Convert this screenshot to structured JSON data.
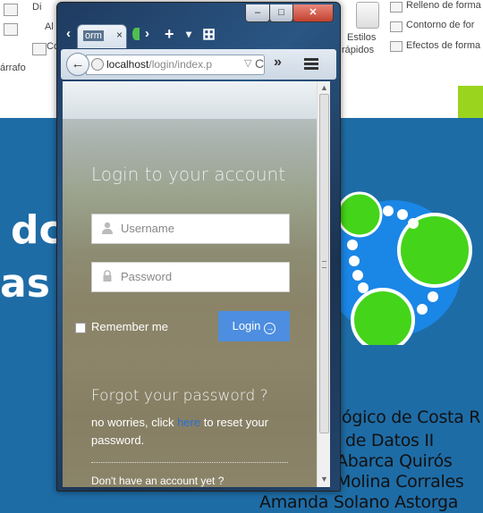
{
  "ribbon": {
    "paragraph_label": "árrafo",
    "di_label": "Di",
    "al_label": "Al",
    "co_label": "Co",
    "estilos_label": "Estilos",
    "rapidos_label": "rápidos",
    "relleno_label": "Relleno de forma",
    "contorno_label": "Contorno de for",
    "efectos_label": "Efectos de forma"
  },
  "slide": {
    "big_line1": "dc",
    "big_line2": "as c",
    "line1": "ógico de Costa R",
    "line2": "de Datos II",
    "line3": "Abarca Quirós",
    "line4": "Molina Corrales",
    "line5": "Amanda Solano Astorga",
    "colors": {
      "slide_bg": "#1e6ca6",
      "logo_blue": "#1a86e6",
      "logo_green": "#44d41a"
    }
  },
  "browser": {
    "tab_title": "orm",
    "tab_close": "×",
    "window_controls": {
      "minimize": "–",
      "maximize": "□",
      "close": "✕"
    },
    "url_host": "localhost",
    "url_path": "/login/index.p",
    "url_dropdown": "▽",
    "url_reload": "C",
    "overflow": "»",
    "nav_back": "‹",
    "nav_fwd": "›",
    "new_tab": "+",
    "tab_list": "▾",
    "groups": "⊞"
  },
  "page": {
    "title": "Login to your account",
    "username_placeholder": "Username",
    "password_placeholder": "Password",
    "remember_label": "Remember me",
    "login_label": "Login",
    "forgot_title": "Forgot your password ?",
    "forgot_text_before": "no worries, click ",
    "forgot_link": "here",
    "forgot_text_after": " to reset your password.",
    "signup_text": "Don't have an account yet ?",
    "accent_color": "#4d8ee0"
  }
}
